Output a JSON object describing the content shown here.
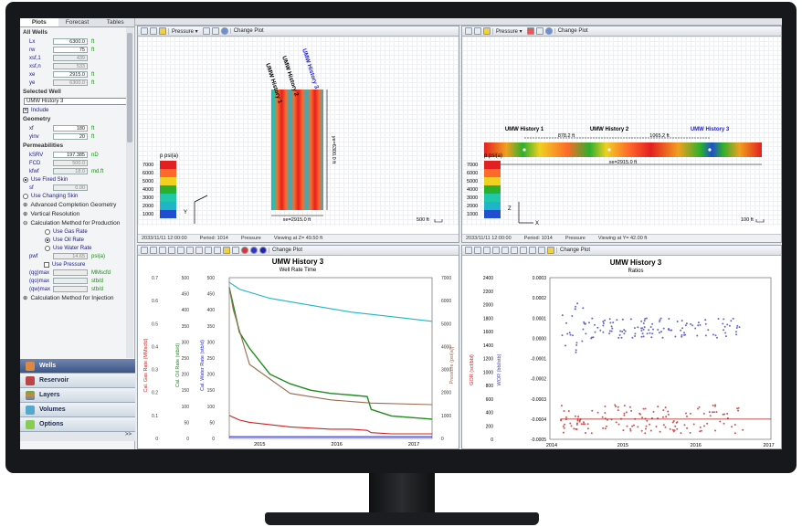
{
  "left": {
    "tabs": [
      "Plots",
      "Forecast",
      "Tables"
    ],
    "sec_all_wells": "All Wells",
    "all_wells": [
      {
        "label": "Lx",
        "value": "6300.0",
        "unit": "ft",
        "gray": false
      },
      {
        "label": "rw",
        "value": "75",
        "unit": "ft",
        "gray": false
      },
      {
        "label": "xsf,1",
        "value": "439",
        "unit": "",
        "gray": true
      },
      {
        "label": "xsf,n",
        "value": "533",
        "unit": "",
        "gray": true
      },
      {
        "label": "xe",
        "value": "2915.0",
        "unit": "ft",
        "gray": false
      },
      {
        "label": "ye",
        "value": "6300.0",
        "unit": "ft",
        "gray": true
      }
    ],
    "sec_selected": "Selected Well",
    "selected_well": "UMW History 3",
    "include": "Include",
    "sec_geometry": "Geometry",
    "geometry": [
      {
        "label": "xf",
        "value": "180",
        "unit": "ft"
      },
      {
        "label": "yinv",
        "value": "20",
        "unit": "ft"
      }
    ],
    "sec_perm": "Permeabilities",
    "perm": [
      {
        "label": "kSRV",
        "value": "197.385",
        "unit": "nD",
        "gray": false
      },
      {
        "label": "FCD",
        "value": "500.0",
        "unit": "",
        "gray": true
      },
      {
        "label": "kfwf",
        "value": "18.0",
        "unit": "md.ft",
        "gray": true
      }
    ],
    "fixed_skin": "Use Fixed Skin",
    "skin_label": "sf",
    "skin_value": "0.00",
    "changing_skin": "Use Changing Skin",
    "adv": "Advanced Completion Geometry",
    "vert": "Vertical Resolution",
    "calc": "Calculation Method for Production",
    "calc_opts": [
      "Use Gas Rate",
      "Use Oil Rate",
      "Use Water Rate"
    ],
    "pwf_label": "pwf",
    "pwf_value": "14.65",
    "pwf_unit": "psi(a)",
    "use_pressure": "Use Pressure",
    "q_rows": [
      {
        "label": "(qg)max",
        "unit": "MMscfd"
      },
      {
        "label": "(qo)max",
        "unit": "stb/d"
      },
      {
        "label": "(qw)max",
        "unit": "stb/d"
      }
    ],
    "calc_inj": "Calculation Method for Injection",
    "nav": [
      "Wells",
      "Reservoir",
      "Layers",
      "Volumes",
      "Options"
    ],
    "more": ">>"
  },
  "top_left": {
    "dropdown": "Pressure",
    "change_plot": "Change Plot",
    "legend_title": "p psi(a)",
    "legend": [
      "7000",
      "6000",
      "5000",
      "4000",
      "3000",
      "2000",
      "1000"
    ],
    "wells": [
      "UMW History 1",
      "UMW History 2",
      "UMW History 3"
    ],
    "ye_label": "ye=6300.0 ft",
    "xe_label": "xe=2915.0 ft",
    "scale": "500 ft",
    "status": [
      "2033/11/11 12:00:00",
      "Period: 1014",
      "Pressure",
      "Viewing at Z= 49.50 ft"
    ]
  },
  "top_right": {
    "dropdown": "Pressure",
    "change_plot": "Change Plot",
    "legend_title": "p psi(a)",
    "legend": [
      "7000",
      "6000",
      "5000",
      "4000",
      "3000",
      "2000",
      "1000"
    ],
    "wells": [
      "UMW History 1",
      "UMW History 2",
      "UMW History 3"
    ],
    "dist1": "878.2 ft",
    "dist2": "1065.2 ft",
    "xe_label": "xe=2915.0 ft",
    "scale": "100 ft",
    "status": [
      "2033/11/11 12:00:00",
      "Period: 1014",
      "Pressure",
      "Viewing at Y= 42.00 ft"
    ]
  },
  "bottom_left": {
    "change_plot": "Change Plot",
    "title": "UMW History 3",
    "subtitle": "Well Rate Time",
    "y1_label": "Cal. Gas Rate (MMscfd)",
    "y2_label": "Cal. Oil Rate (stb/d)",
    "y3_label": "Cal. Water Rate (stb/d)",
    "y4_label": "Pressure (psi(a))"
  },
  "bottom_right": {
    "change_plot": "Change Plot",
    "title": "UMW History 3",
    "subtitle": "Ratios",
    "y1_label": "GOR (scf/bbl)",
    "y2_label": "WOR (bbl/stb)"
  },
  "chart_data": [
    {
      "type": "line",
      "title": "UMW History 3",
      "subtitle": "Well Rate Time",
      "x": [
        "2015",
        "2016",
        "2017"
      ],
      "axes": [
        {
          "label": "Cal. Gas Rate (MMscfd)",
          "range": [
            0,
            0.7
          ],
          "ticks": [
            0.0,
            0.1,
            0.2,
            0.3,
            0.4,
            0.5,
            0.6,
            0.7
          ]
        },
        {
          "label": "Cal. Oil Rate (stb/d)",
          "range": [
            0,
            500
          ],
          "ticks": [
            0,
            50,
            100,
            150,
            200,
            250,
            300,
            350,
            400,
            450,
            500
          ]
        },
        {
          "label": "Cal. Water Rate (stb/d)",
          "range": [
            0,
            500
          ],
          "ticks": [
            0,
            50,
            100,
            150,
            200,
            250,
            300,
            350,
            400,
            450,
            500
          ]
        },
        {
          "label": "Pressure (psi(a))",
          "range": [
            0,
            7000
          ],
          "ticks": [
            0,
            1000,
            2000,
            3000,
            4000,
            5000,
            6000,
            7000
          ]
        }
      ],
      "series": [
        {
          "color": "#1fb5c9",
          "t": [
            0,
            0.05,
            0.2,
            0.4,
            0.6,
            0.8,
            1.0
          ],
          "v": [
            6800,
            6500,
            6100,
            5800,
            5500,
            5300,
            5100
          ]
        },
        {
          "color": "#1e8c1e",
          "t": [
            0,
            0.05,
            0.1,
            0.2,
            0.3,
            0.4,
            0.5,
            0.6,
            0.68,
            0.7,
            0.8,
            1.0
          ],
          "v": [
            470,
            330,
            280,
            200,
            170,
            150,
            140,
            135,
            130,
            90,
            70,
            60
          ]
        },
        {
          "color": "#cc2222",
          "t": [
            0,
            0.05,
            0.1,
            0.2,
            0.3,
            0.4,
            0.5,
            0.6,
            0.68,
            0.7,
            0.8,
            1.0
          ],
          "v": [
            0.1,
            0.08,
            0.07,
            0.06,
            0.05,
            0.045,
            0.04,
            0.04,
            0.035,
            0.025,
            0.02,
            0.02
          ]
        },
        {
          "color": "#9a6b4f",
          "t": [
            0,
            0.02,
            0.1,
            0.3,
            0.5,
            0.7,
            1.0
          ],
          "v": [
            470,
            400,
            230,
            140,
            120,
            110,
            105
          ]
        },
        {
          "color": "#2a2acc",
          "t": [
            0,
            1.0
          ],
          "v": [
            5,
            5
          ]
        }
      ]
    },
    {
      "type": "scatter",
      "title": "UMW History 3",
      "subtitle": "Ratios",
      "x": [
        "2014",
        "2015",
        "2016",
        "2017"
      ],
      "axes": [
        {
          "label": "GOR (scf/bbl)",
          "range": [
            0,
            2400
          ],
          "ticks": [
            0,
            200,
            400,
            600,
            800,
            1000,
            1200,
            1400,
            1600,
            1800,
            2000,
            2200,
            2400
          ]
        },
        {
          "label": "WOR (bbl/stb)",
          "range": [
            -0.0005,
            0.0003
          ],
          "ticks": [
            "0.0003",
            "0.0002",
            "0.0001",
            "0.0000",
            "-0.0001",
            "-0.0002",
            "-0.0003",
            "-0.0004",
            "-0.0005"
          ]
        }
      ],
      "series": [
        {
          "name": "",
          "color": "#6666cc",
          "mean": 5e-05
        },
        {
          "name": "",
          "color": "#cc5555",
          "mean": -0.0004
        }
      ]
    }
  ]
}
